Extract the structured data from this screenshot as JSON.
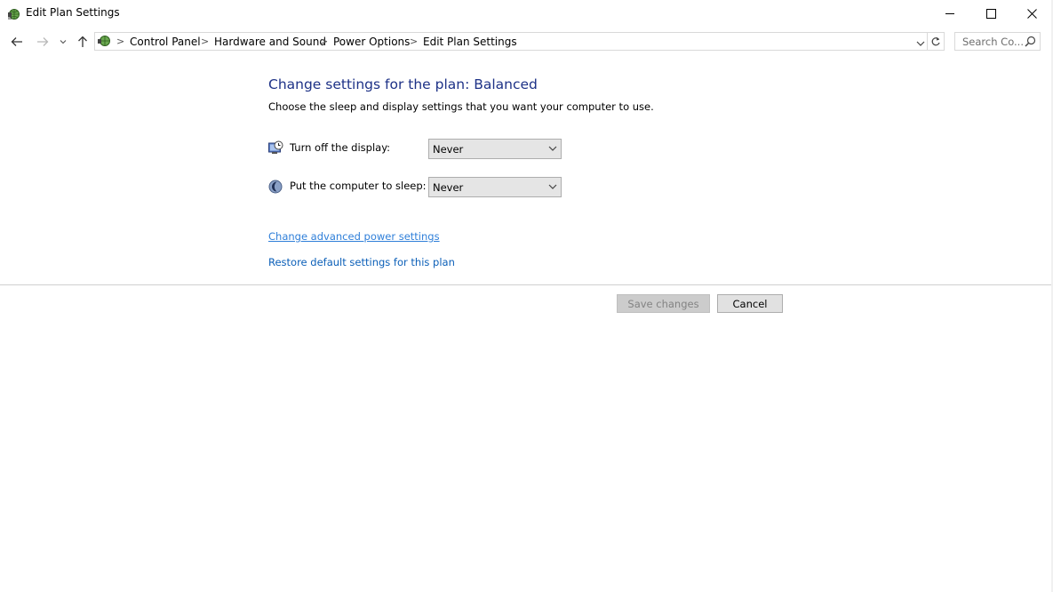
{
  "window": {
    "title": "Edit Plan Settings",
    "controls": {
      "minimize": "minimize",
      "maximize": "maximize",
      "close": "close"
    }
  },
  "nav": {
    "breadcrumbs": [
      "Control Panel",
      "Hardware and Sound",
      "Power Options",
      "Edit Plan Settings"
    ],
    "separator": ">",
    "search_placeholder": "Search Co..."
  },
  "main": {
    "heading": "Change settings for the plan: Balanced",
    "subtext": "Choose the sleep and display settings that you want your computer to use.",
    "settings": [
      {
        "label": "Turn off the display:",
        "value": "Never",
        "icon": "display-clock-icon"
      },
      {
        "label": "Put the computer to sleep:",
        "value": "Never",
        "icon": "sleep-moon-icon"
      }
    ],
    "links": {
      "advanced": "Change advanced power settings",
      "restore": "Restore default settings for this plan"
    },
    "buttons": {
      "save": "Save changes",
      "cancel": "Cancel"
    }
  },
  "colors": {
    "heading": "#1e3287",
    "link": "#0b5fb8",
    "dropdown_bg": "#e5e5e5",
    "disabled_button_bg": "#cccccc"
  }
}
